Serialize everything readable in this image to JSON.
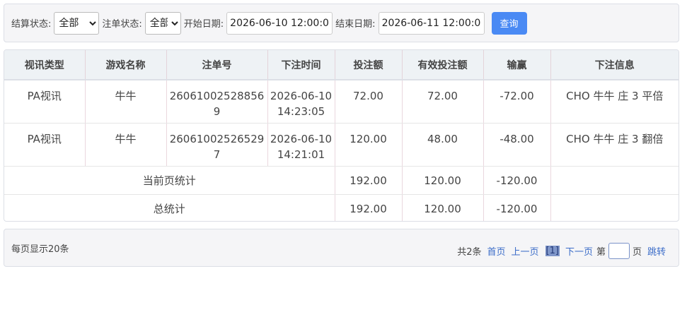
{
  "filters": {
    "settle_label": "结算状态:",
    "settle_value": "全部",
    "order_label": "注单状态:",
    "order_value": "全部",
    "start_label": "开始日期:",
    "start_value": "2026-06-10 12:00:00",
    "end_label": "结束日期:",
    "end_value": "2026-06-11 12:00:00",
    "query_label": "查询"
  },
  "table": {
    "headers": [
      "视讯类型",
      "游戏名称",
      "注单号",
      "下注时间",
      "投注额",
      "有效投注额",
      "输赢",
      "下注信息"
    ],
    "rows": [
      [
        "PA视讯",
        "牛牛",
        "260610025288569",
        "2026-06-10 14:23:05",
        "72.00",
        "72.00",
        "-72.00",
        "CHO 牛牛 庄 3 平倍"
      ],
      [
        "PA视讯",
        "牛牛",
        "260610025265297",
        "2026-06-10 14:21:01",
        "120.00",
        "48.00",
        "-48.00",
        "CHO 牛牛 庄 3 翻倍"
      ]
    ],
    "page_total": {
      "label": "当前页统计",
      "bet": "192.00",
      "valid": "120.00",
      "winloss": "-120.00"
    },
    "grand_total": {
      "label": "总统计",
      "bet": "192.00",
      "valid": "120.00",
      "winloss": "-120.00"
    }
  },
  "pager": {
    "per_page": "每页显示20条",
    "total": "共2条",
    "first": "首页",
    "prev": "上一页",
    "current": "[1]",
    "next": "下一页",
    "goto_prefix": "第",
    "goto_value": "",
    "goto_suffix": "页",
    "jump": "跳转"
  }
}
